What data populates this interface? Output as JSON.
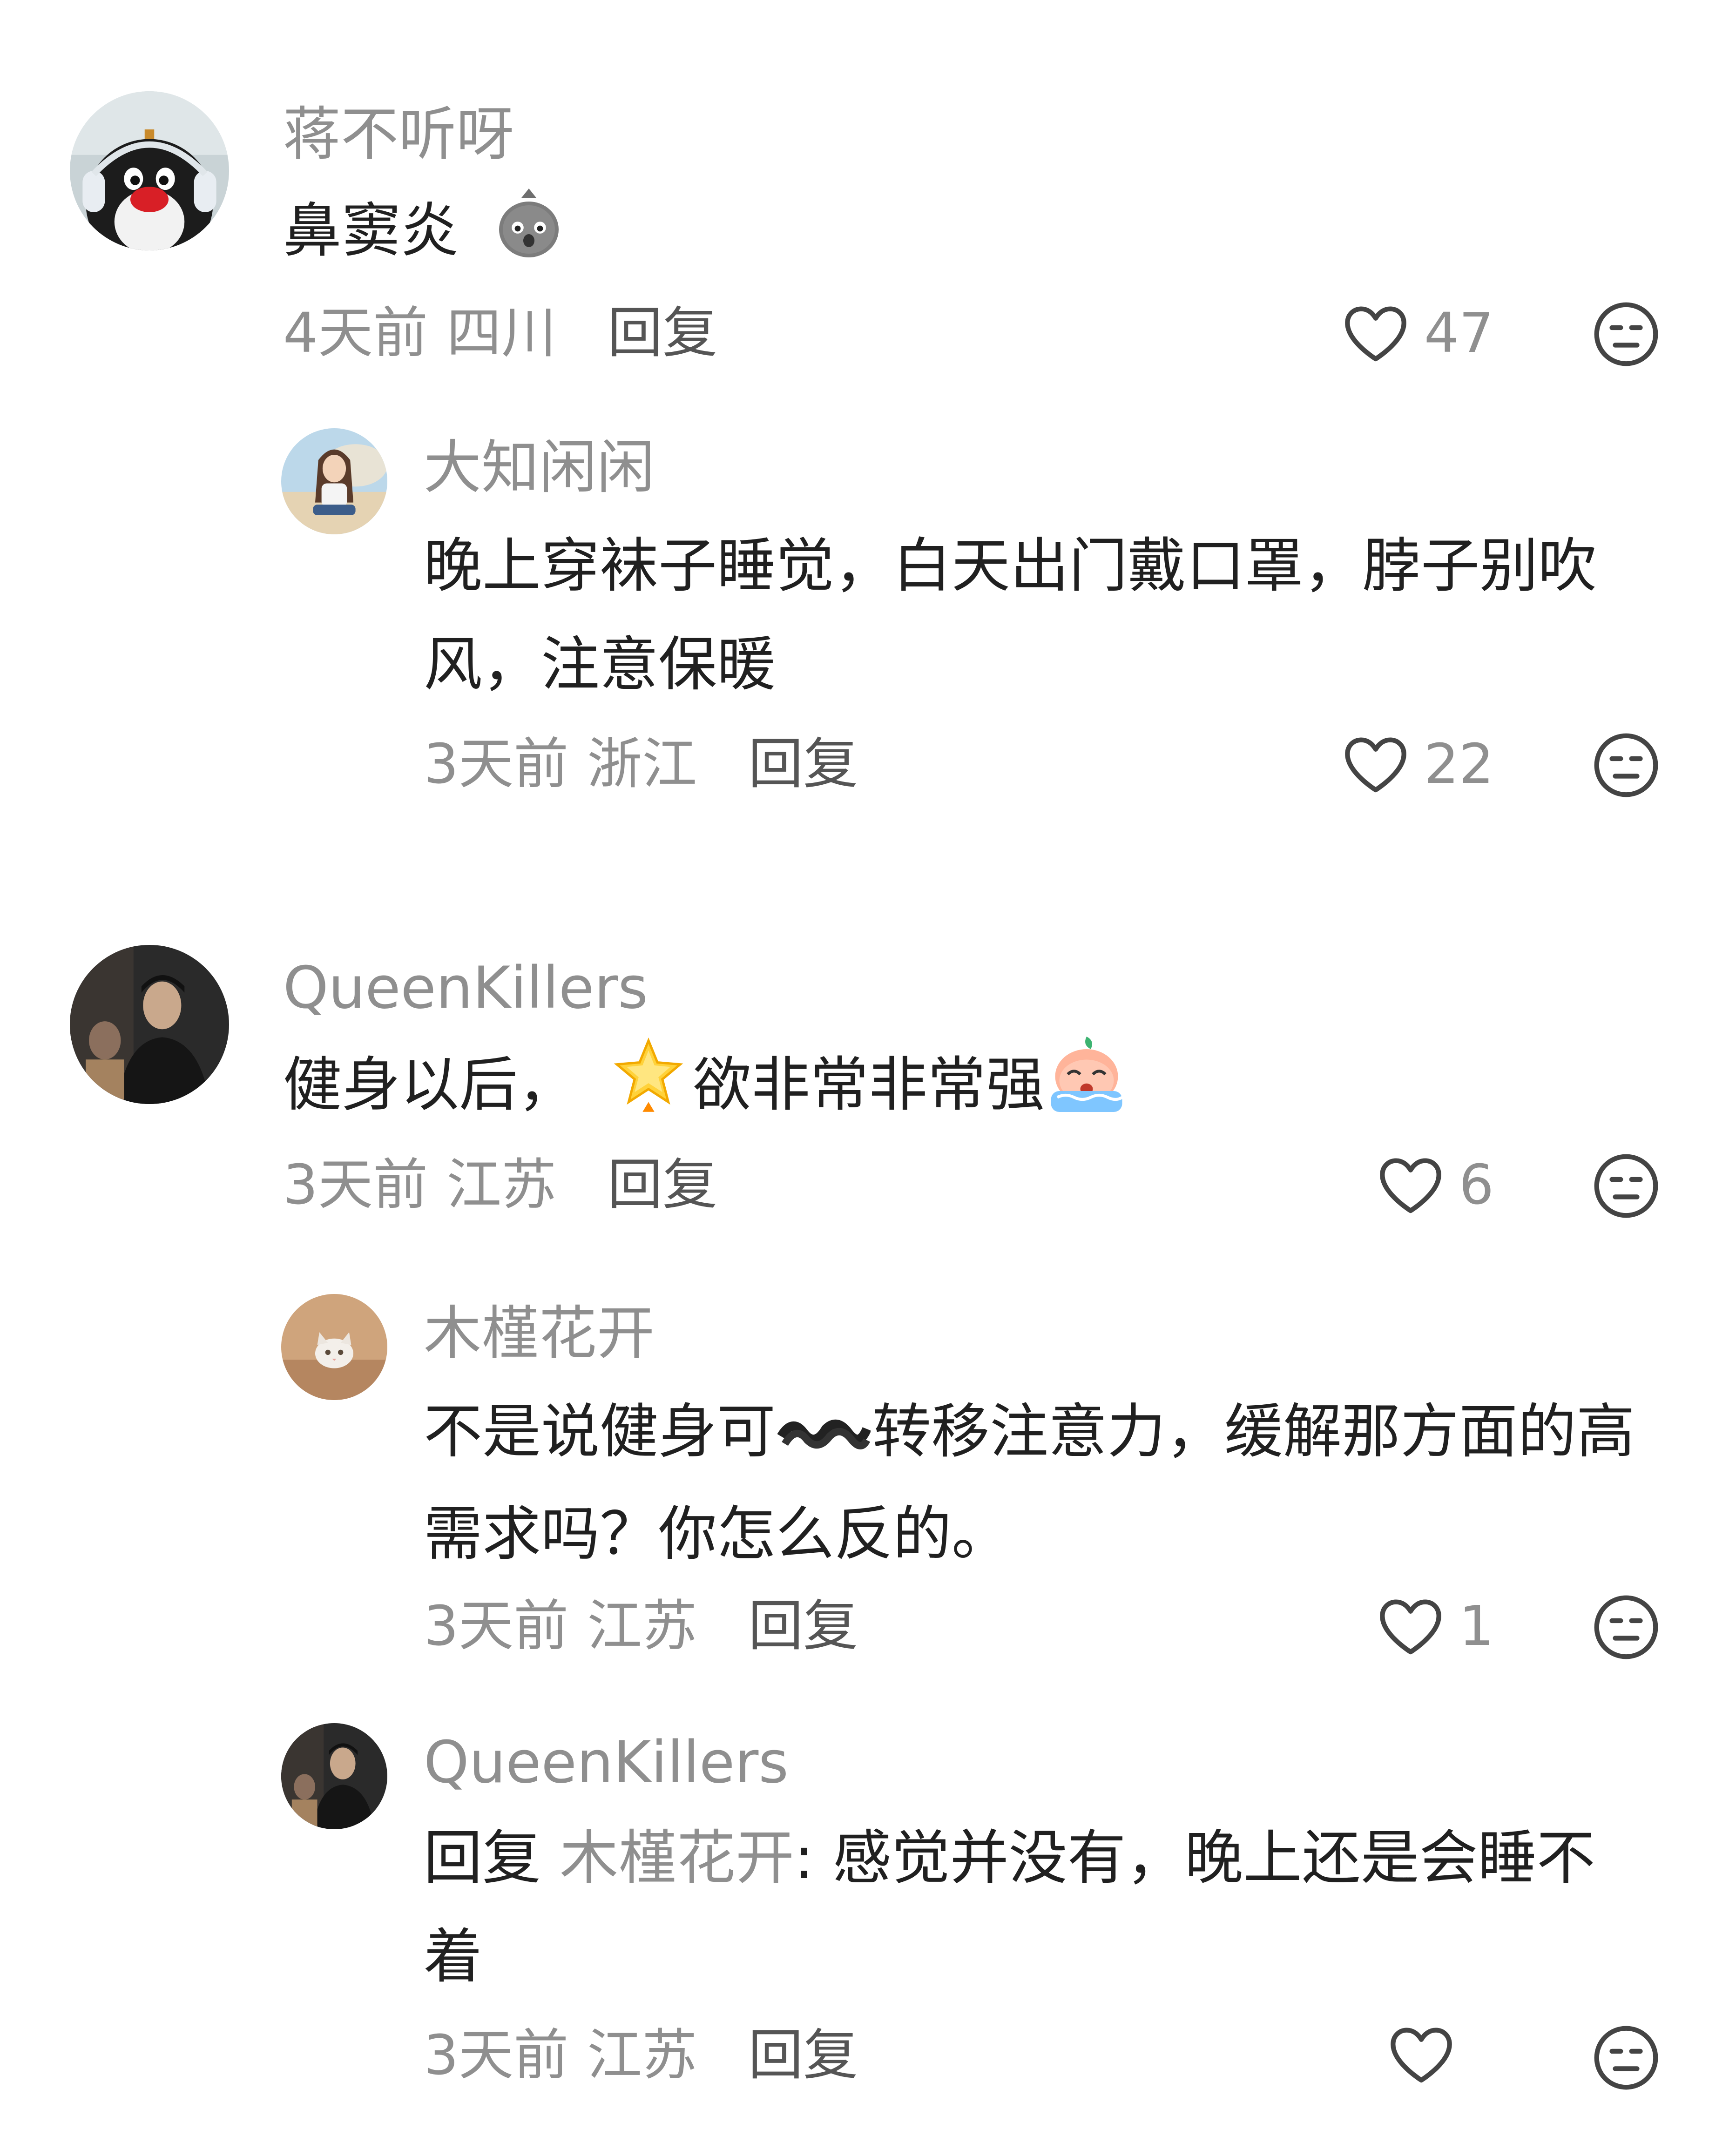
{
  "comments": [
    {
      "username": "蒋不听呀",
      "content": "鼻窦炎",
      "time": "4天前",
      "location": "四川",
      "reply_label": "回复",
      "likes": "47",
      "avatar": "penguin-headphones-avatar"
    },
    {
      "username": "大知闲闲",
      "content": "晚上穿袜子睡觉，白天出门戴口罩，脖子别吹风，注意保暖",
      "time": "3天前",
      "location": "浙江",
      "reply_label": "回复",
      "likes": "22",
      "avatar": "anime-girl-avatar"
    },
    {
      "username": "QueenKillers",
      "content_before": "健身以后，",
      "content_after": "欲非常非常强",
      "time": "3天前",
      "location": "江苏",
      "reply_label": "回复",
      "likes": "6",
      "avatar": "man-photo-avatar"
    },
    {
      "username": "木槿花开",
      "content_part1": "不是说健身可",
      "content_part2": "转移注意力，缓解那方面的高",
      "content_line2": "需求吗？你怎么反的。",
      "time": "3天前",
      "location": "江苏",
      "reply_label": "回复",
      "likes": "1",
      "avatar": "cat-avatar"
    },
    {
      "username": "QueenKillers",
      "reply_prefix": "回复",
      "reply_mention": "木槿花开",
      "content_line1": ": 感觉并没有，晚上还是会睡不",
      "content_line2": "着",
      "time": "3天前",
      "location": "江苏",
      "reply_label": "回复",
      "avatar": "man-photo-avatar"
    }
  ],
  "icons": {
    "like": "heart-outline-icon",
    "dislike": "meh-face-icon"
  },
  "colors": {
    "username": "#8f8f8f",
    "content": "#202020",
    "meta": "#8f8f8f",
    "reply": "#555555"
  }
}
